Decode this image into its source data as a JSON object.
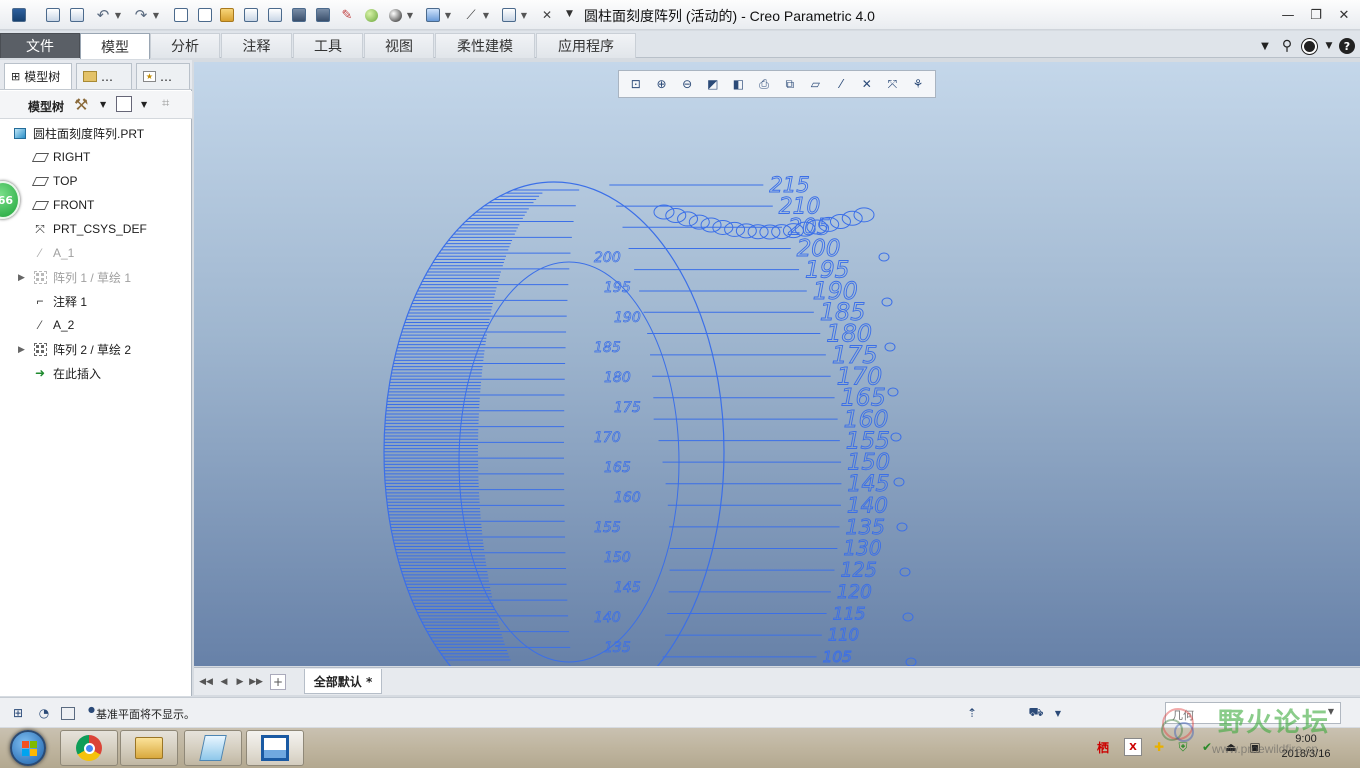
{
  "window": {
    "title": "圆柱面刻度阵列 (活动的) - Creo Parametric 4.0",
    "minimize": "—",
    "restore": "❐",
    "close": "✕"
  },
  "quick_access": [
    "app-menu-icon",
    "regenerate-icon",
    "regenerate-manager-icon",
    "undo-icon",
    "redo-icon",
    "copy-icon",
    "new-icon",
    "open-icon",
    "open-from-server-icon",
    "save-backup-icon",
    "save-icon",
    "save-as-icon",
    "erase-icon",
    "appearance-icon",
    "shading-icon",
    "view-icon",
    "measure-icon",
    "select-icon",
    "close-window-icon"
  ],
  "ribbon": {
    "tabs": [
      {
        "label": "文件",
        "state": "file"
      },
      {
        "label": "模型",
        "state": "active"
      },
      {
        "label": "分析",
        "state": ""
      },
      {
        "label": "注释",
        "state": ""
      },
      {
        "label": "工具",
        "state": ""
      },
      {
        "label": "视图",
        "state": ""
      },
      {
        "label": "柔性建模",
        "state": ""
      },
      {
        "label": "应用程序",
        "state": ""
      }
    ]
  },
  "left_panel": {
    "tabs": [
      {
        "label": "模型树"
      },
      {
        "label": "…"
      },
      {
        "label": "…"
      }
    ],
    "toolbar_label": "模型树",
    "tree": [
      {
        "label": "圆柱面刻度阵列.PRT",
        "icon": "part-icon",
        "dim": false,
        "expandable": false
      },
      {
        "label": "RIGHT",
        "icon": "datum-plane-icon",
        "dim": false,
        "expandable": false
      },
      {
        "label": "TOP",
        "icon": "datum-plane-icon",
        "dim": false,
        "expandable": false
      },
      {
        "label": "FRONT",
        "icon": "datum-plane-icon",
        "dim": false,
        "expandable": false
      },
      {
        "label": "PRT_CSYS_DEF",
        "icon": "csys-icon",
        "dim": false,
        "expandable": false
      },
      {
        "label": "A_1",
        "icon": "datum-axis-icon",
        "dim": true,
        "expandable": false
      },
      {
        "label": "阵列 1 / 草绘 1",
        "icon": "pattern-icon",
        "dim": true,
        "expandable": true
      },
      {
        "label": "注释 1",
        "icon": "annotation-icon",
        "dim": false,
        "expandable": false
      },
      {
        "label": "A_2",
        "icon": "datum-axis-icon",
        "dim": false,
        "expandable": false
      },
      {
        "label": "阵列 2 / 草绘 2",
        "icon": "pattern-icon",
        "dim": false,
        "expandable": true
      },
      {
        "label": "在此插入",
        "icon": "insert-here-icon",
        "dim": false,
        "expandable": false
      }
    ],
    "badge": "66"
  },
  "graphics": {
    "view_toolbar": [
      "refit-icon",
      "zoom-in-icon",
      "zoom-out-icon",
      "repaint-icon",
      "display-style-icon",
      "saved-orientations-icon",
      "view-manager-icon",
      "plane-display-icon",
      "axis-display-icon",
      "point-display-icon",
      "csys-display-icon",
      "spin-center-icon"
    ],
    "scale_labels": [
      "215",
      "210",
      "205",
      "200",
      "195",
      "190",
      "185",
      "180",
      "175",
      "170",
      "165",
      "160",
      "155",
      "150",
      "145",
      "140",
      "135",
      "130",
      "125",
      "120",
      "115",
      "110",
      "105"
    ],
    "colors": {
      "geometry": "#3b6fe8",
      "bg_top": "#c4d7ea",
      "bg_bottom": "#6781a8"
    }
  },
  "bottom_tabs": {
    "layer_tab": "全部默认 *"
  },
  "status": {
    "message": "基准平面将不显示。",
    "filter": "几何"
  },
  "taskbar": {
    "apps": [
      "chrome-icon",
      "explorer-icon",
      "notepad-icon",
      "creo-icon"
    ],
    "time": "9:00",
    "date": "2018/3/16"
  },
  "watermark": {
    "site": "野火论坛",
    "url": "www.proewildfire.cn"
  }
}
